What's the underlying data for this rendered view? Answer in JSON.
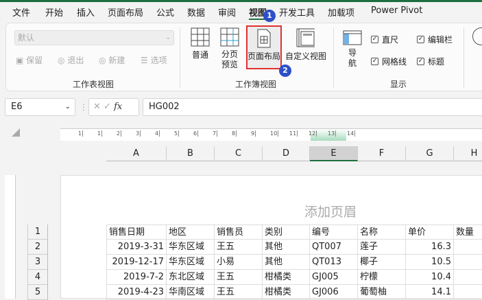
{
  "tabs": [
    "文件",
    "开始",
    "插入",
    "页面布局",
    "公式",
    "数据",
    "审阅",
    "视图",
    "开发工具",
    "加载项",
    "Power Pivot"
  ],
  "active_tab": "视图",
  "ribbon": {
    "sheet_view": {
      "select_value": "默认",
      "buttons": [
        "保留",
        "退出",
        "新建",
        "选项"
      ],
      "label": "工作表视图"
    },
    "workbook_view": {
      "buttons": [
        "普通",
        "分页\n预览",
        "页面布局",
        "自定义视图"
      ],
      "normal": "普通",
      "pagebreak_1": "分页",
      "pagebreak_2": "预览",
      "page_layout": "页面布局",
      "custom": "自定义视图",
      "label": "工作簿视图"
    },
    "show": {
      "nav_1": "导",
      "nav_2": "航",
      "ruler": "直尺",
      "formula_bar": "编辑栏",
      "gridlines": "网格线",
      "headings": "标题",
      "label": "显示"
    },
    "badges": [
      "1",
      "2"
    ]
  },
  "formula_bar": {
    "name_box": "E6",
    "value": "HG002",
    "fx": "fx"
  },
  "ruler": [
    "1",
    "1",
    "2",
    "3",
    "4",
    "5",
    "6",
    "7",
    "8",
    "9",
    "10",
    "11",
    "12",
    "13",
    "14"
  ],
  "columns": [
    "A",
    "B",
    "C",
    "D",
    "E",
    "F",
    "G",
    "H"
  ],
  "selected_column": "E",
  "header_placeholder": "添加页眉",
  "rows": [
    {
      "n": "1",
      "cells": [
        "销售日期",
        "地区",
        "销售员",
        "类别",
        "编号",
        "名称",
        "单价",
        "数量"
      ]
    },
    {
      "n": "2",
      "cells": [
        "2019-3-31",
        "华东区域",
        "王五",
        "其他",
        "QT007",
        "莲子",
        "16.3",
        ""
      ]
    },
    {
      "n": "3",
      "cells": [
        "2019-12-17",
        "华东区域",
        "小易",
        "其他",
        "QT013",
        "椰子",
        "10.5",
        ""
      ]
    },
    {
      "n": "4",
      "cells": [
        "2019-7-2",
        "东北区域",
        "王五",
        "柑橘类",
        "GJ005",
        "柠檬",
        "10.4",
        ""
      ]
    },
    {
      "n": "5",
      "cells": [
        "2019-4-23",
        "华南区域",
        "王五",
        "柑橘类",
        "GJ006",
        "葡萄柚",
        "14.1",
        ""
      ]
    }
  ]
}
